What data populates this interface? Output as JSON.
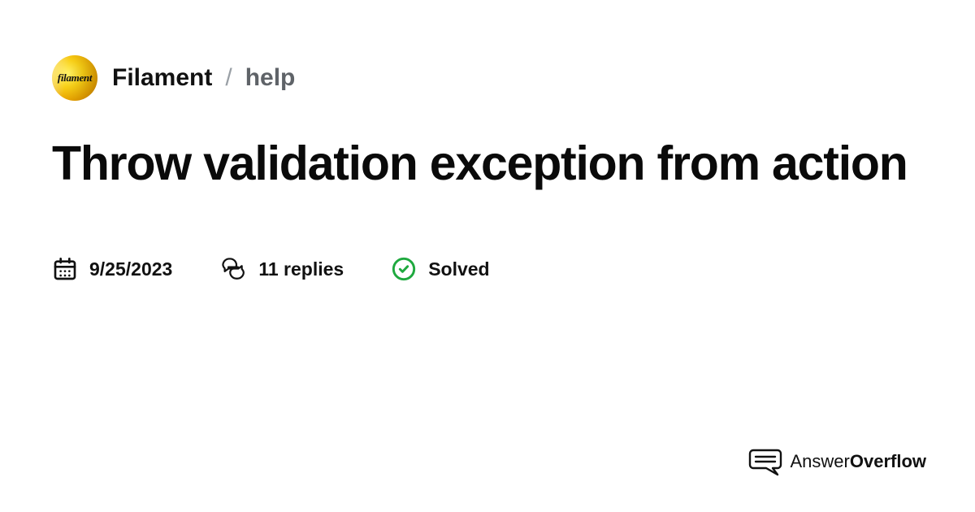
{
  "breadcrumb": {
    "avatar_label": "filament",
    "community": "Filament",
    "separator": "/",
    "channel": "help"
  },
  "post": {
    "title": "Throw validation exception from action"
  },
  "meta": {
    "date": "9/25/2023",
    "replies": "11 replies",
    "status": "Solved"
  },
  "footer": {
    "brand_first": "Answer",
    "brand_second": "Overflow"
  },
  "colors": {
    "solved_green": "#1fa93f"
  }
}
